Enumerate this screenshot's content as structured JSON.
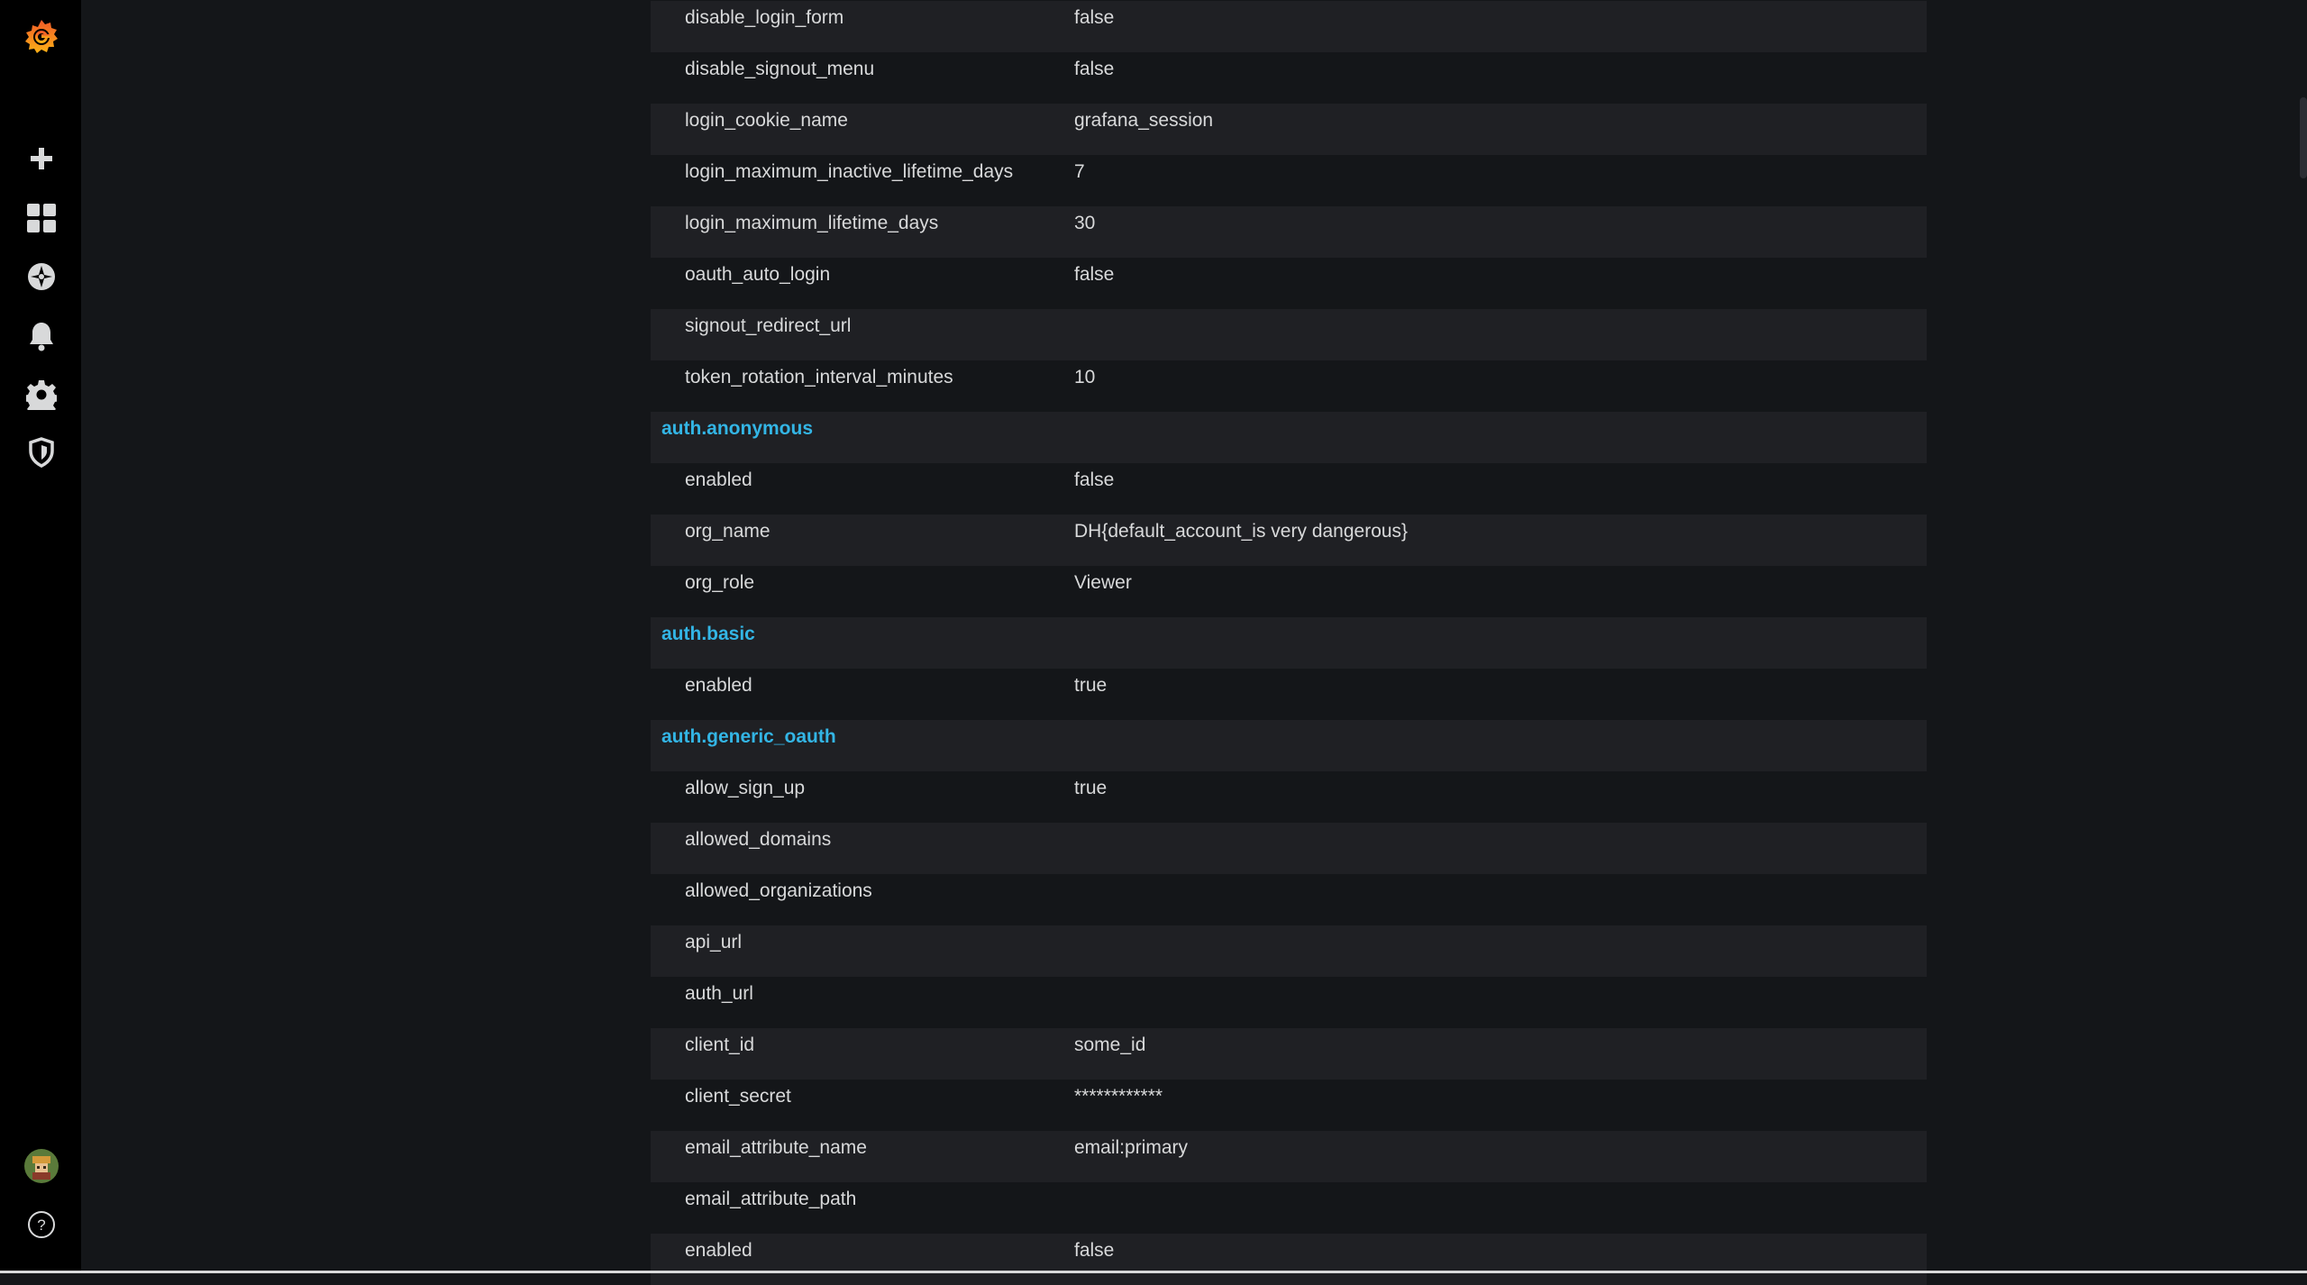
{
  "sidebar": {
    "logo": "grafana-logo",
    "items": [
      {
        "icon": "plus-icon",
        "label": "Create"
      },
      {
        "icon": "dashboards-icon",
        "label": "Dashboards"
      },
      {
        "icon": "explore-compass-icon",
        "label": "Explore"
      },
      {
        "icon": "bell-icon",
        "label": "Alerting"
      },
      {
        "icon": "gear-icon",
        "label": "Configuration"
      },
      {
        "icon": "shield-icon",
        "label": "Server Admin"
      }
    ],
    "bottom": [
      {
        "icon": "avatar",
        "label": "Profile"
      },
      {
        "icon": "help-icon",
        "label": "Help"
      }
    ]
  },
  "settings": {
    "rows": [
      {
        "type": "kv",
        "key": "disable_login_form",
        "value": "false"
      },
      {
        "type": "kv",
        "key": "disable_signout_menu",
        "value": "false"
      },
      {
        "type": "kv",
        "key": "login_cookie_name",
        "value": "grafana_session"
      },
      {
        "type": "kv",
        "key": "login_maximum_inactive_lifetime_days",
        "value": "7"
      },
      {
        "type": "kv",
        "key": "login_maximum_lifetime_days",
        "value": "30"
      },
      {
        "type": "kv",
        "key": "oauth_auto_login",
        "value": "false"
      },
      {
        "type": "kv",
        "key": "signout_redirect_url",
        "value": ""
      },
      {
        "type": "kv",
        "key": "token_rotation_interval_minutes",
        "value": "10"
      },
      {
        "type": "section",
        "title": "auth.anonymous"
      },
      {
        "type": "kv",
        "key": "enabled",
        "value": "false"
      },
      {
        "type": "kv",
        "key": "org_name",
        "value": "DH{default_account_is very dangerous}"
      },
      {
        "type": "kv",
        "key": "org_role",
        "value": "Viewer"
      },
      {
        "type": "section",
        "title": "auth.basic"
      },
      {
        "type": "kv",
        "key": "enabled",
        "value": "true"
      },
      {
        "type": "section",
        "title": "auth.generic_oauth"
      },
      {
        "type": "kv",
        "key": "allow_sign_up",
        "value": "true"
      },
      {
        "type": "kv",
        "key": "allowed_domains",
        "value": ""
      },
      {
        "type": "kv",
        "key": "allowed_organizations",
        "value": ""
      },
      {
        "type": "kv",
        "key": "api_url",
        "value": ""
      },
      {
        "type": "kv",
        "key": "auth_url",
        "value": ""
      },
      {
        "type": "kv",
        "key": "client_id",
        "value": "some_id"
      },
      {
        "type": "kv",
        "key": "client_secret",
        "value": "************"
      },
      {
        "type": "kv",
        "key": "email_attribute_name",
        "value": "email:primary"
      },
      {
        "type": "kv",
        "key": "email_attribute_path",
        "value": ""
      },
      {
        "type": "kv",
        "key": "enabled",
        "value": "false"
      }
    ]
  },
  "colors": {
    "accent": "#33b5e5",
    "row_odd": "#1f2024",
    "row_even": "#141619",
    "text": "#d8d9da",
    "sidebar_bg": "#000000",
    "logo_orange": "#f46800"
  }
}
